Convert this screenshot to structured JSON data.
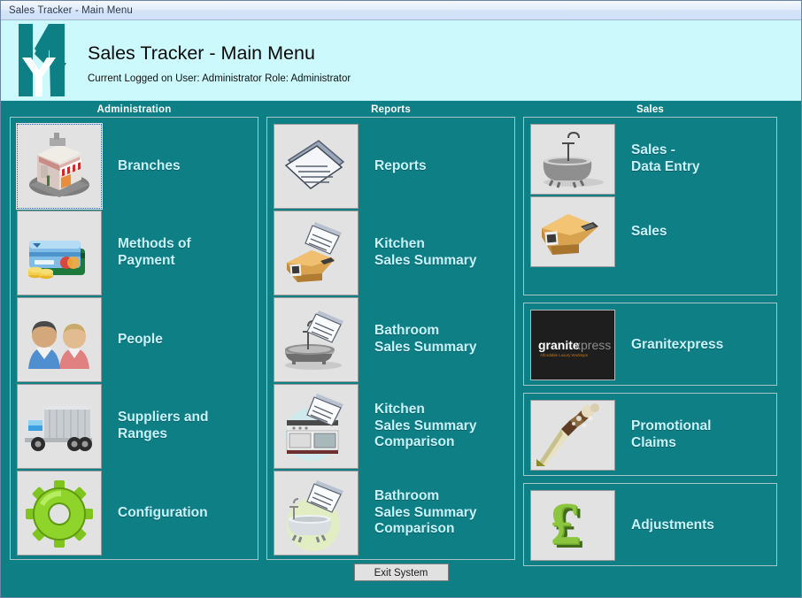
{
  "window": {
    "title": "Sales Tracker - Main Menu"
  },
  "header": {
    "app_title": "Sales Tracker - Main Menu",
    "user_status": "Current Logged on User: Administrator  Role: Administrator",
    "logo_text": "KYK",
    "background": "#ccf9fb"
  },
  "theme": {
    "teal": "#0d7f85",
    "label_text": "#c9f3fb",
    "header_text": "#ffffff",
    "thumb_background": "#e2e2e2"
  },
  "columns": [
    {
      "id": "administration",
      "header": "Administration",
      "groups": [
        {
          "items": [
            {
              "label": "Branches",
              "icon": "shop-building-icon",
              "focused": true
            },
            {
              "label": "Methods of\nPayment",
              "icon": "credit-cards-coins-icon",
              "focused": false
            },
            {
              "label": "People",
              "icon": "two-people-icon",
              "focused": false
            },
            {
              "label": "Suppliers and\nRanges",
              "icon": "delivery-truck-icon",
              "focused": false
            },
            {
              "label": "Configuration",
              "icon": "green-gear-icon",
              "focused": false
            }
          ]
        }
      ]
    },
    {
      "id": "reports",
      "header": "Reports",
      "groups": [
        {
          "items": [
            {
              "label": "Reports",
              "icon": "documents-icon",
              "focused": false
            },
            {
              "label": "Kitchen\nSales Summary",
              "icon": "kitchen-counter-document-icon",
              "focused": false
            },
            {
              "label": "Bathroom\nSales Summary",
              "icon": "bathtub-document-icon",
              "focused": false
            },
            {
              "label": "Kitchen\nSales Summary\nComparison",
              "icon": "kitchen-range-document-icon",
              "focused": false
            },
            {
              "label": "Bathroom\nSales Summary\nComparison",
              "icon": "clawfoot-bath-document-icon",
              "focused": false
            }
          ]
        }
      ]
    },
    {
      "id": "sales",
      "header": "Sales",
      "groups": [
        {
          "items": [
            {
              "label": "Sales -\nData Entry",
              "icon": "bathtub-icon",
              "focused": false
            },
            {
              "label": "Sales",
              "icon": "kitchen-counter-icon",
              "focused": false
            }
          ]
        },
        {
          "items": [
            {
              "label": "Granitexpress",
              "icon": "granitexpress-logo-icon",
              "focused": false
            }
          ]
        },
        {
          "items": [
            {
              "label": "Promotional\nClaims",
              "icon": "champagne-bottle-icon",
              "focused": false
            }
          ]
        },
        {
          "items": [
            {
              "label": "Adjustments",
              "icon": "pound-sign-icon",
              "focused": false
            }
          ]
        }
      ]
    }
  ],
  "granitexpress_logo": {
    "word_bold": "granite",
    "word_light": "xpress",
    "tagline": "Affordable Luxury Worktops"
  },
  "footer": {
    "exit_label": "Exit System"
  }
}
